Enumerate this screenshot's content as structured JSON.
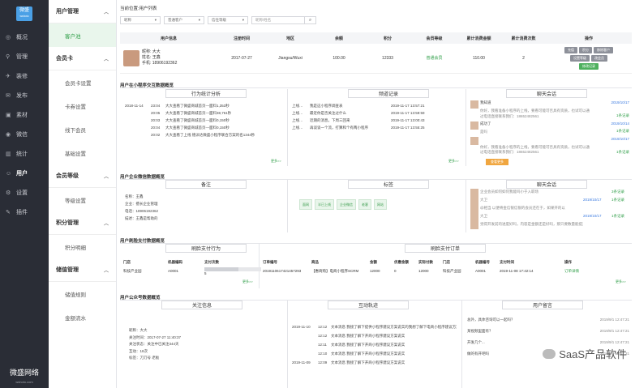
{
  "brand": {
    "logo": "微盛",
    "logo_sub": "wshoto",
    "name": "微盛网络",
    "domain": "wshoto.com"
  },
  "nav": [
    {
      "icon": "◎",
      "label": "概况"
    },
    {
      "icon": "⚲",
      "label": "管理"
    },
    {
      "icon": "✈",
      "label": "装修"
    },
    {
      "icon": "✉",
      "label": "发布"
    },
    {
      "icon": "▣",
      "label": "素材"
    },
    {
      "icon": "◉",
      "label": "微信"
    },
    {
      "icon": "▥",
      "label": "统计"
    },
    {
      "icon": "☺",
      "label": "用户"
    },
    {
      "icon": "⚙",
      "label": "设置"
    },
    {
      "icon": "✎",
      "label": "插件"
    }
  ],
  "sub": {
    "g1": {
      "title": "用户管理",
      "items": [
        "客户池"
      ]
    },
    "g2": {
      "title": "会员卡",
      "items": [
        "会员卡设置",
        "卡券设置",
        "线下会员",
        "基础设置"
      ]
    },
    "g3": {
      "title": "会员等级",
      "items": [
        "等级设置"
      ]
    },
    "g4": {
      "title": "积分管理",
      "items": [
        "积分明细"
      ]
    },
    "g5": {
      "title": "储值管理",
      "items": [
        "储值规则",
        "金额流水"
      ]
    }
  },
  "crumb": "当前位置:用户列表",
  "filters": {
    "f1": "昵称",
    "f2": "普通客户",
    "f3": "信任等级",
    "search": "昵称/姓名"
  },
  "table": {
    "headers": [
      "用户信息",
      "注册时间",
      "地区",
      "余额",
      "积分",
      "会员等级",
      "累计消费金额",
      "累计消费次数",
      "操作"
    ],
    "row": {
      "name": "昵称: 大大",
      "real": "姓名: 王鑫",
      "phone": "手机: 18906192362",
      "date": "2017-07-27",
      "region": "Jiangsu/Wuxi",
      "balance": "100.00",
      "points": "12333",
      "level": "普通会员",
      "amount": "110.00",
      "times": "2"
    },
    "buttons": [
      "充值",
      "积分",
      "移除客户",
      "设置等级",
      "改会员",
      "修改记录"
    ]
  },
  "s1": {
    "title": "用户在小程序交互数据概览",
    "p1": "行为统计分析",
    "p2": "频道记录",
    "p3": "聊天会话",
    "log": [
      [
        "2018-11-14",
        "23:04",
        "大大查看了微盛商城首页—面料1,353秒"
      ],
      [
        "",
        "20:05",
        "大大查看了微盛商城首页—面料38,761秒"
      ],
      [
        "",
        "20:03",
        "大大查看了微盛商城首页—面料0,150秒"
      ],
      [
        "",
        "20:04",
        "大大查看了微盛商城首页—面料0,150秒"
      ],
      [
        "",
        "20:02",
        "大大查看了上线 德派达微盛小程序联合方案的名1344秒"
      ]
    ],
    "chan": [
      [
        "上线…",
        "我是这小程序调查表",
        "2019-11-17 13:57:21"
      ],
      [
        "上线…",
        "最近你是否关注过什么",
        "2019-11-17 13:59:59"
      ],
      [
        "上线…",
        "近期的消息，下周三回来",
        "2019-11-17 13:00:43"
      ],
      [
        "上线…",
        "再谈谈一个流，打算和个有两小程序",
        "2019-11-17 13:55:25"
      ]
    ],
    "chat": [
      [
        "我知道",
        "2019/10/17",
        "1条记录",
        "你好，我看准备小程序的上线，要看可能可否具有资质，也试可以通过电话直接联系我们：18652482561"
      ],
      [
        "成功了",
        "2019/10/14",
        "1条记录",
        "是吗"
      ],
      [
        "",
        "2019/10/17",
        "1条记录",
        "你好，我看准备小程序的上线，要看可能可否具有资质，也试可以通过电话直接联系我们：18652482561"
      ]
    ],
    "view_btn": "查看更多"
  },
  "s2": {
    "title": "用户企业微信数据概览",
    "p1": "备注",
    "p2": "标签",
    "p3": "聊天会话",
    "info": [
      "名称：王鑫",
      "企业：擅长企业管理",
      "电话：18906192362",
      "描述：王鑫是帮助的"
    ],
    "tags": [
      "面网",
      "半已上线",
      "企业微信",
      "老客",
      "网站"
    ],
    "chat": [
      [
        "企业会员如何如何我能吗小于入职场",
        "",
        "3条记录"
      ],
      [
        "大卫",
        "2019/10/17",
        "1条记录"
      ],
      [
        "@相当 以便将金信银信银的会员还在于，如果开的以",
        "",
        ""
      ],
      [
        "大卫",
        "2019/10/17",
        "1条记录"
      ],
      [
        "觉得开发前的进度好吗，内容是金额还是好吗，那只要数量能提升什么的有费用的吗？还是由此的金额看着",
        "",
        ""
      ]
    ]
  },
  "s3": {
    "title": "用户刷脸支付数据概览",
    "p1": "刷脸支付行为",
    "p2": "刷脸支付订单",
    "h1": [
      "门店",
      "机器编码",
      "支付次数"
    ],
    "r1": [
      "科技产业园",
      "A0001",
      "5"
    ],
    "h2": [
      "订单编号",
      "商品",
      "金额",
      "优惠金额",
      "实际付款",
      "门店",
      "机器编号",
      "支付时间",
      "操作"
    ],
    "r2": [
      "2019110617421457293",
      "【惠商购】电商小程序SCRM",
      "12000",
      "0",
      "12000",
      "科技产业园",
      "A0001",
      "2019-11-08 17:42:14",
      "订单详情"
    ]
  },
  "s4": {
    "title": "用户公众号数据概览",
    "p1": "关注信息",
    "p2": "互动轨迹",
    "p3": "用户留言",
    "info": [
      "昵称：大大",
      "关注时间：2017-07-27 11:40:37",
      "关注状态：关注中已关注344天",
      "互动：18次",
      "标签：刀刀号 老板"
    ],
    "track": [
      [
        "2019-11-10",
        "12:12",
        "文本消息 我接了解下提供小程序建议方案说实的我想了解下电商小程序建议方案说的同学"
      ],
      [
        "",
        "12:12",
        "文本消息 我接了解下开商小程序建议方案说实"
      ],
      [
        "",
        "12:11",
        "文本消息 我接了解下开商小程序建议方案说实"
      ],
      [
        "",
        "12:10",
        "文本消息 我接了解下开商小程序建议方案说实"
      ],
      [
        "2019-11-09",
        "12:09",
        "文本消息 我接了解下开商小程序建议方案说实"
      ]
    ],
    "msg": [
      [
        "总外，具体咨询可以一起吗？",
        "2019/9/1 12:47:21"
      ],
      [
        "某视频里面有？",
        "2019/9/1 12:47:21"
      ],
      [
        "开发几个...",
        "2019/9/1 12:47:21"
      ],
      [
        "做的有开吧吗",
        "2019/9/1 12:47:21"
      ]
    ]
  },
  "more": "更多>>",
  "watermark": "SaaS产品软件"
}
